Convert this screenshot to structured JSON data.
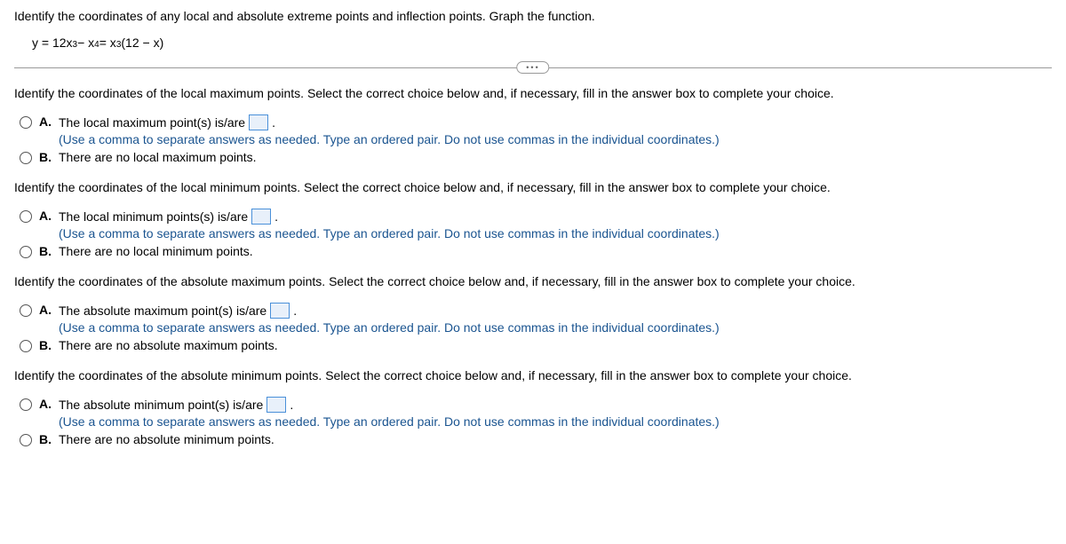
{
  "question": "Identify the coordinates of any local and absolute extreme points and inflection points. Graph the function.",
  "equation_text": "y = 12x³ − x⁴ = x³(12 − x)",
  "q1": {
    "prompt": "Identify the coordinates of the local maximum points. Select the correct choice below and, if necessary, fill in the answer box to complete your choice.",
    "a_pre": "The local maximum point(s) is/are ",
    "a_post": ".",
    "hint": "(Use a comma to separate answers as needed. Type an ordered pair. Do not use commas in the individual coordinates.)",
    "b": "There are no local maximum points."
  },
  "q2": {
    "prompt": "Identify the coordinates of the local minimum points. Select the correct choice below and, if necessary, fill in the answer box to complete your choice.",
    "a_pre": "The local minimum points(s) is/are ",
    "a_post": ".",
    "hint": "(Use a comma to separate answers as needed. Type an ordered pair. Do not use commas in the individual coordinates.)",
    "b": "There are no local minimum points."
  },
  "q3": {
    "prompt": "Identify the coordinates of the absolute maximum points. Select the correct choice below and, if necessary, fill in the answer box to complete your choice.",
    "a_pre": "The absolute maximum point(s) is/are ",
    "a_post": ".",
    "hint": "(Use a comma to separate answers as needed. Type an ordered pair. Do not use commas in the individual coordinates.)",
    "b": "There are no absolute maximum points."
  },
  "q4": {
    "prompt": "Identify the coordinates of the absolute minimum points. Select the correct choice below and, if necessary, fill in the answer box to complete your choice.",
    "a_pre": "The absolute minimum point(s) is/are ",
    "a_post": ".",
    "hint": "(Use a comma to separate answers as needed. Type an ordered pair. Do not use commas in the individual coordinates.)",
    "b": "There are no absolute minimum points."
  },
  "labels": {
    "A": "A.",
    "B": "B."
  },
  "ellipsis": "•••"
}
